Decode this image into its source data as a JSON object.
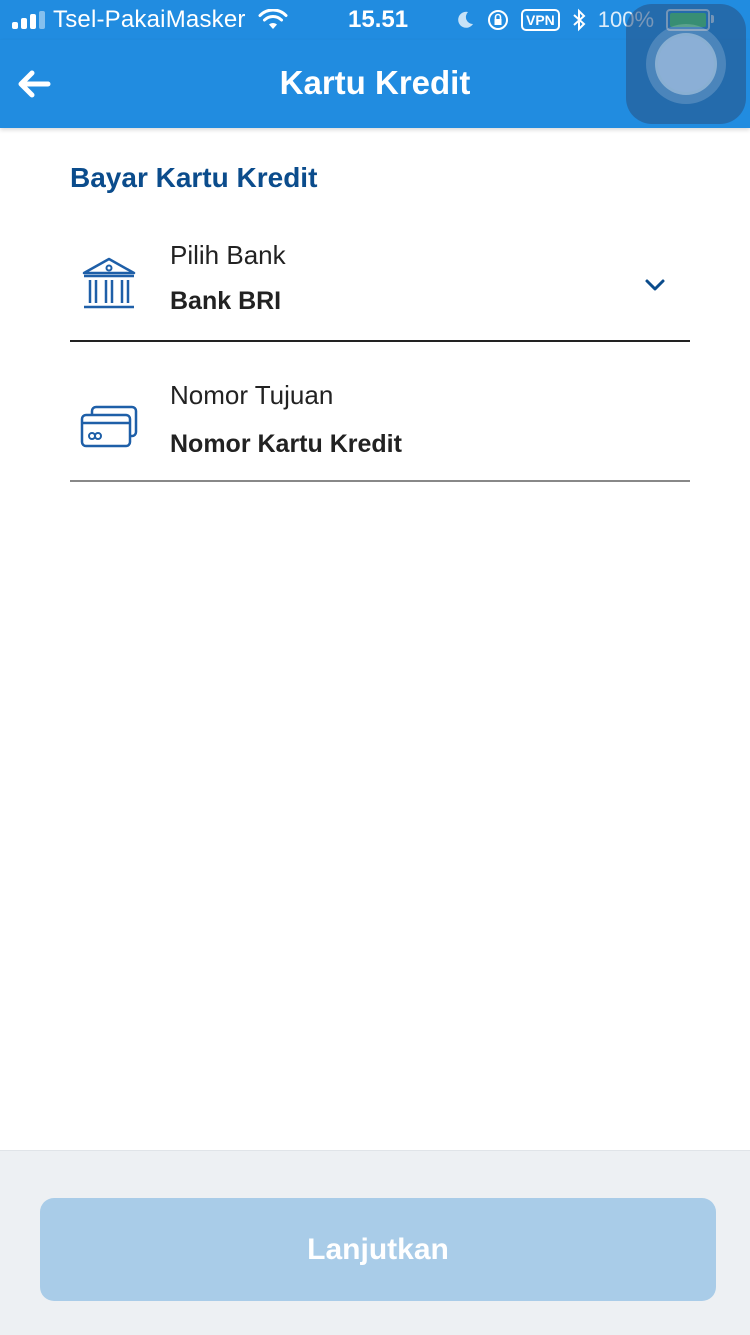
{
  "status_bar": {
    "carrier": "Tsel-PakaiMasker",
    "time": "15.51",
    "vpn": "VPN",
    "battery_percent": "100%"
  },
  "header": {
    "title": "Kartu Kredit",
    "back_icon": "arrow-left-icon"
  },
  "form": {
    "section_title": "Bayar Kartu Kredit",
    "bank_field": {
      "label": "Pilih Bank",
      "value": "Bank BRI",
      "icon": "bank-icon"
    },
    "number_field": {
      "label": "Nomor Tujuan",
      "placeholder": "Nomor Kartu Kredit",
      "icon": "credit-card-icon"
    }
  },
  "footer": {
    "continue_label": "Lanjutkan"
  },
  "colors": {
    "primary": "#218CE0",
    "section_title": "#0B4C8C",
    "button_disabled": "#A9CCE8"
  }
}
